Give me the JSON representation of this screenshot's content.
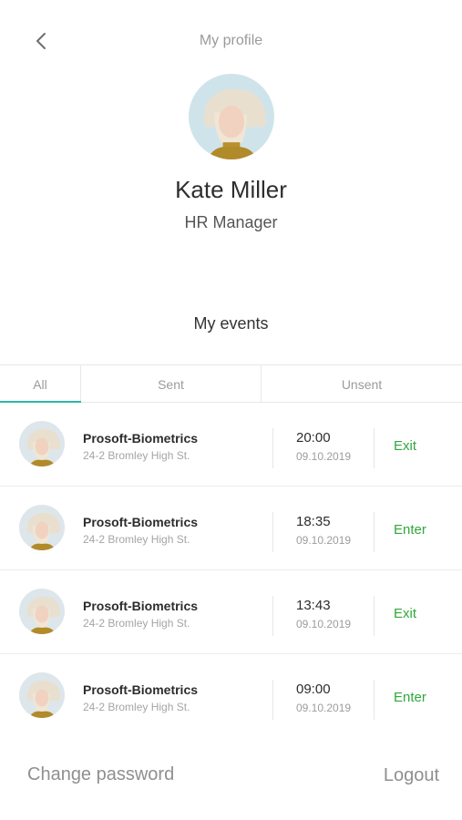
{
  "header": {
    "title": "My profile"
  },
  "profile": {
    "name": "Kate Miller",
    "role": "HR Manager"
  },
  "events_section": {
    "title": "My events"
  },
  "tabs": [
    {
      "label": "All",
      "active": true
    },
    {
      "label": "Sent",
      "active": false
    },
    {
      "label": "Unsent",
      "active": false
    }
  ],
  "events": [
    {
      "title": "Prosoft-Biometrics",
      "address": "24-2 Bromley High St.",
      "time": "20:00",
      "date": "09.10.2019",
      "type": "Exit"
    },
    {
      "title": "Prosoft-Biometrics",
      "address": "24-2 Bromley High St.",
      "time": "18:35",
      "date": "09.10.2019",
      "type": "Enter"
    },
    {
      "title": "Prosoft-Biometrics",
      "address": "24-2 Bromley High St.",
      "time": "13:43",
      "date": "09.10.2019",
      "type": "Exit"
    },
    {
      "title": "Prosoft-Biometrics",
      "address": "24-2 Bromley High St.",
      "time": "09:00",
      "date": "09.10.2019",
      "type": "Enter"
    }
  ],
  "footer": {
    "change_password": "Change password",
    "logout": "Logout"
  },
  "colors": {
    "accent": "#2bb5a5",
    "event_type": "#2fa83a"
  },
  "icons": {
    "back": "chevron-left-icon",
    "avatar": "user-photo"
  }
}
